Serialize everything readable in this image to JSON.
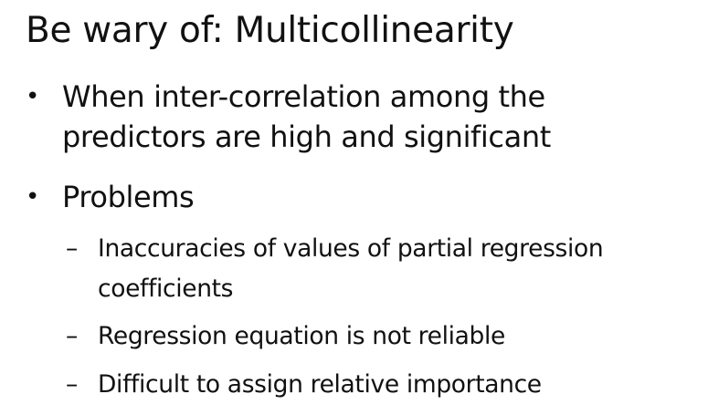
{
  "slide": {
    "title": "Be wary of: Multicollinearity",
    "bullets": [
      {
        "marker": "•",
        "lines": [
          "When inter-correlation among the",
          "predictors are high and significant"
        ]
      },
      {
        "marker": "•",
        "lines": [
          "Problems"
        ],
        "sub_bullets": [
          {
            "marker": "–",
            "lines": [
              "Inaccuracies of values of partial regression",
              "coefficients"
            ]
          },
          {
            "marker": "–",
            "lines": [
              "Regression equation is not reliable"
            ]
          },
          {
            "marker": "–",
            "lines": [
              "Difficult to assign relative importance"
            ]
          }
        ]
      }
    ]
  }
}
